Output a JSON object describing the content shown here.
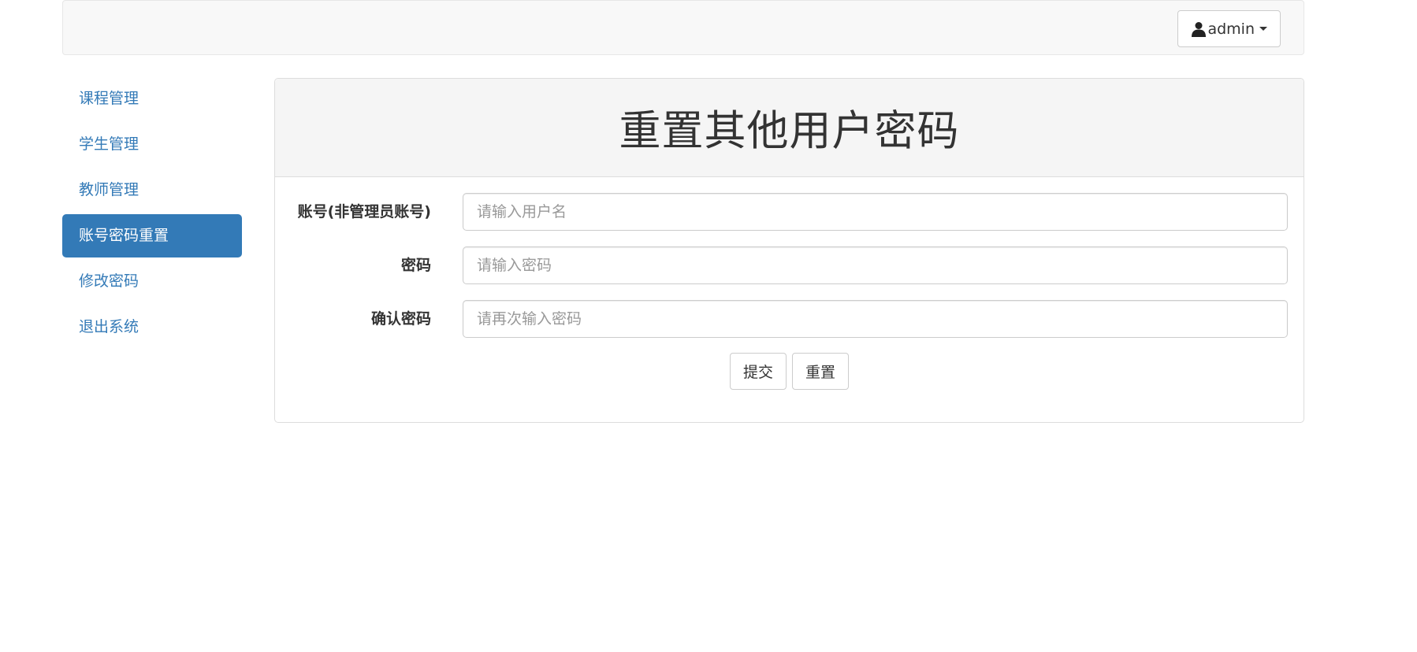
{
  "navbar": {
    "user_label": "admin"
  },
  "sidebar": {
    "items": [
      {
        "label": "课程管理",
        "active": false
      },
      {
        "label": "学生管理",
        "active": false
      },
      {
        "label": "教师管理",
        "active": false
      },
      {
        "label": "账号密码重置",
        "active": true
      },
      {
        "label": "修改密码",
        "active": false
      },
      {
        "label": "退出系统",
        "active": false
      }
    ]
  },
  "panel": {
    "title": "重置其他用户密码"
  },
  "form": {
    "fields": [
      {
        "label": "账号(非管理员账号)",
        "placeholder": "请输入用户名",
        "value": ""
      },
      {
        "label": "密码",
        "placeholder": "请输入密码",
        "value": ""
      },
      {
        "label": "确认密码",
        "placeholder": "请再次输入密码",
        "value": ""
      }
    ],
    "submit_label": "提交",
    "reset_label": "重置"
  },
  "colors": {
    "primary": "#337ab7",
    "navbar_bg": "#f8f8f8",
    "panel_heading_bg": "#f5f5f5",
    "text": "#333333",
    "placeholder": "#999999"
  },
  "icons": {
    "user": "user-icon",
    "caret": "caret-down-icon"
  }
}
